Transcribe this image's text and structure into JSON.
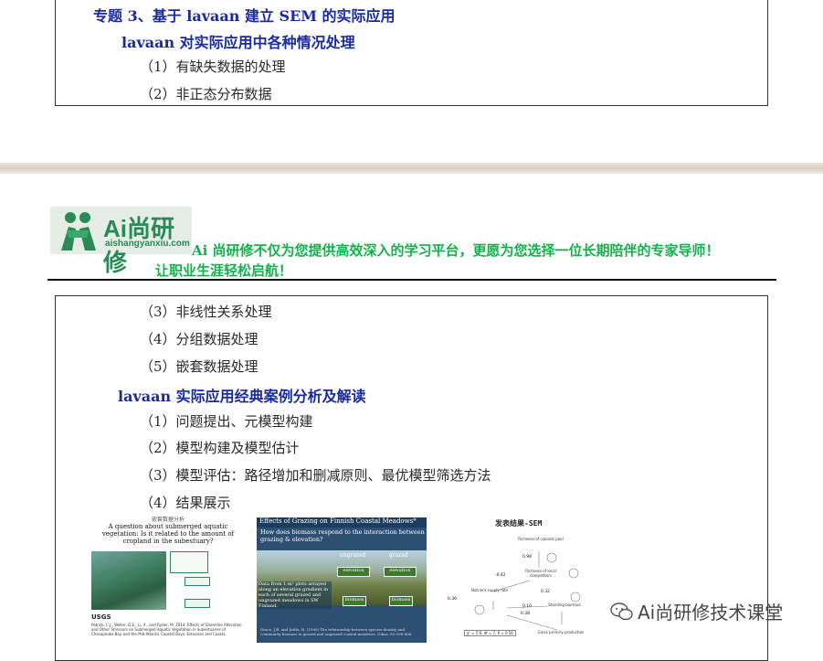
{
  "top_section": {
    "title": "专题 3、基于 lavaan 建立 SEM 的实际应用",
    "subheading": "lavaan 对实际应用中各种情况处理",
    "items": [
      "（1）有缺失数据的处理",
      "（2）非正态分布数据"
    ]
  },
  "brand": {
    "logo_text": "Ai尚研修",
    "logo_url": "aishangyanxiu.com",
    "slogan_line1": "Ai 尚研修不仅为您提供高效深入的学习平台，更愿为您选择一位长期陪伴的专家导师！",
    "slogan_line2": "让职业生涯轻松启航！",
    "colors": {
      "green": "#12b24a",
      "blue_heading": "#1a2aa0"
    }
  },
  "main_section": {
    "items_a": [
      "（3）非线性关系处理",
      "（4）分组数据处理",
      "（5）嵌套数据处理"
    ],
    "subheading": "lavaan 实际应用经典案例分析及解读",
    "items_b": [
      "（1）问题提出、元模型构建",
      "（2）模型构建及模型估计",
      "（3）模型评估：路径增加和删减原则、最优模型筛选方法",
      "（4）结果展示"
    ]
  },
  "figures": {
    "fig1": {
      "header": "嵌套数据分析",
      "question": "A question about submerged aquatic vegetation: Is it related to the amount of cropland in the subestuary?",
      "logo": "USGS",
      "citation": "Patrick, C.J., Weller, D.E., Li, X., and Ryder, M. 2014. Effects of Shoreline Alteration and Other Stressors on Submerged Aquatic Vegetation in Subestuaries of Chesapeake Bay and the Mid-Atlantic Coastal Bays. Estuaries and Coasts."
    },
    "fig2": {
      "title": "Effects of Grazing on Finnish Coastal Meadows*",
      "question": "How does biomass respond to the interaction between grazing & elevation?",
      "labels": [
        "ungrazed",
        "grazed",
        "elevation",
        "elevation",
        "biomass",
        "biomass"
      ],
      "desc": "Data from 1-m² plots arrayed along an elevation gradient in each of several grazed and ungrazed meadows in SW Finland.",
      "citation": "Grace, J.B. and Jutila, H. (1999) The relationship between species density and community biomass in grazed and ungrazed coastal meadows. Oikos, 85:398-408."
    },
    "fig3": {
      "title": "发表结果-SEM",
      "nodes": [
        "Richness of colonist pool",
        "Richness of local competitors",
        "Nutrient supply rate",
        "Standing biomass",
        "Gross primary production"
      ],
      "coefs": [
        "0.98",
        "-0.42",
        "0.32",
        "0.10",
        "0.38",
        "0.36"
      ],
      "fit": "χ² = 5.9, df = 7, P = 0.56"
    }
  },
  "watermark": "Ai尚研修技术课堂"
}
